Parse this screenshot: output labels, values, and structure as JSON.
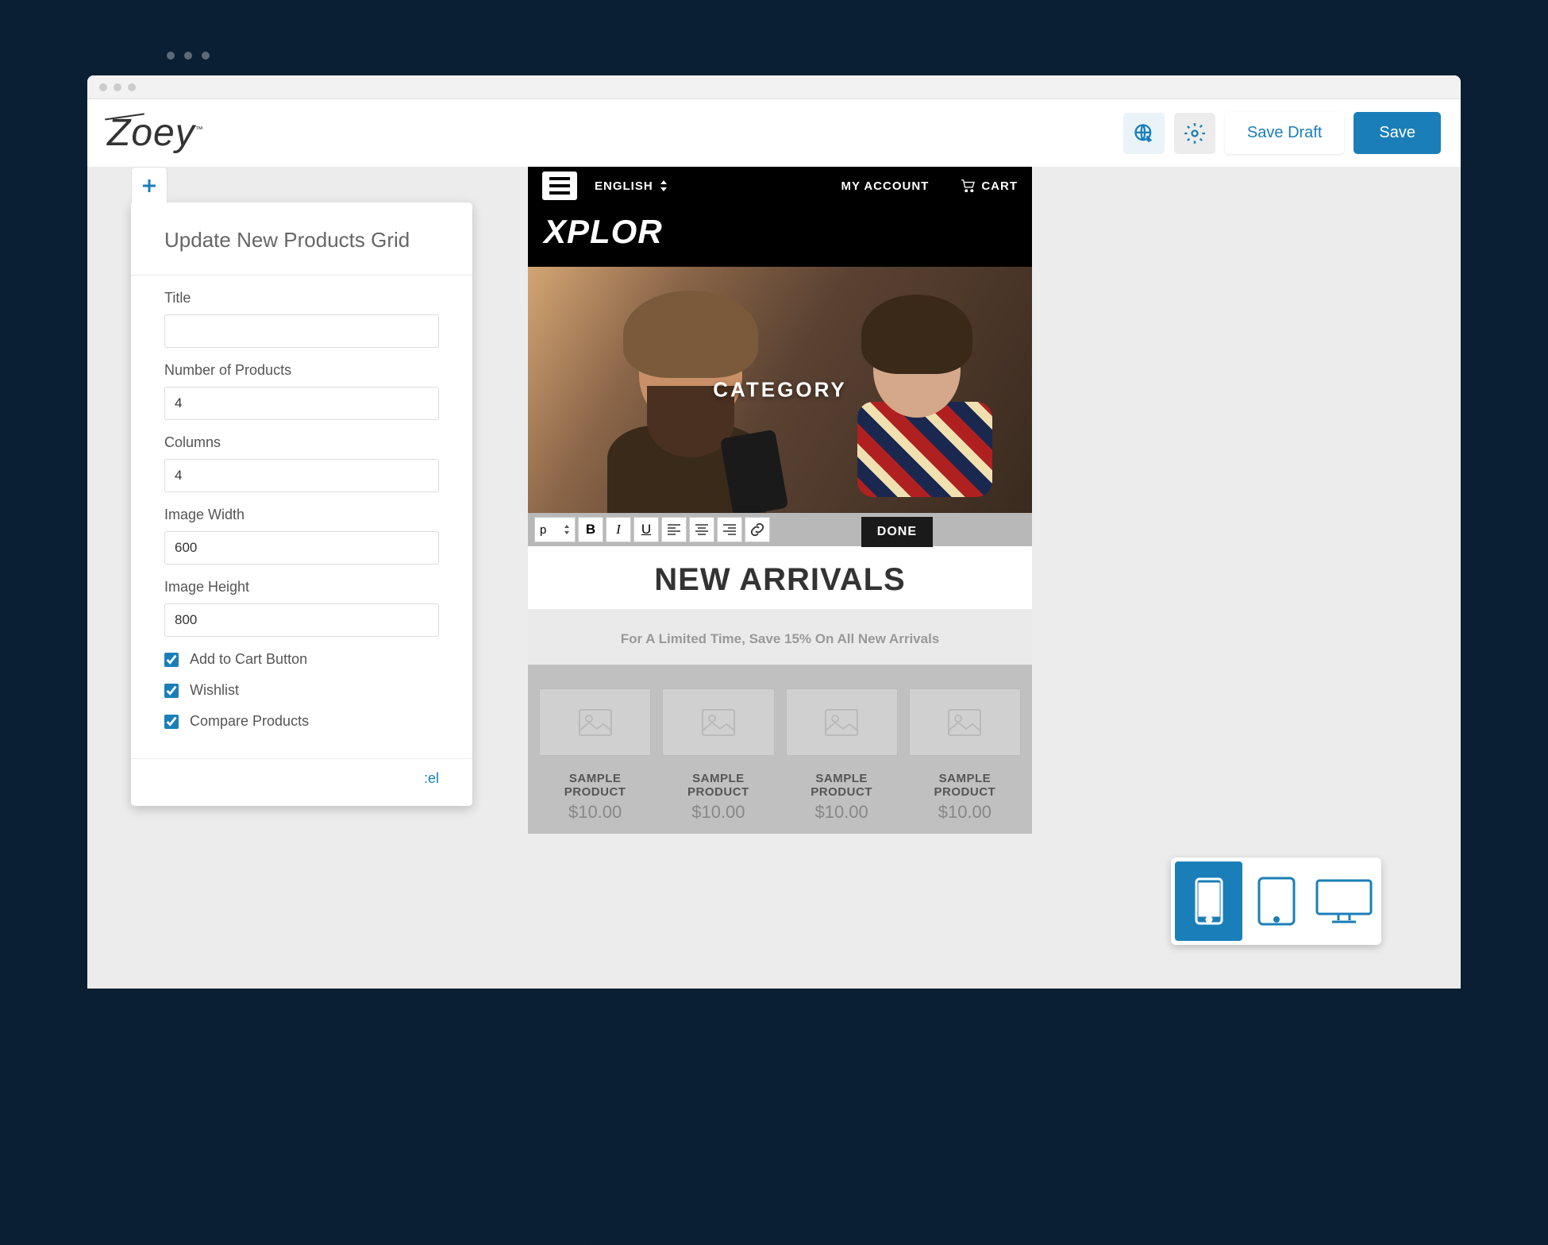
{
  "logo": "Zoey",
  "header": {
    "save_draft_label": "Save Draft",
    "save_label": "Save"
  },
  "panel": {
    "title": "Update New Products Grid",
    "fields": {
      "title_label": "Title",
      "title_value": "",
      "num_products_label": "Number of Products",
      "num_products_value": "4",
      "columns_label": "Columns",
      "columns_value": "4",
      "image_width_label": "Image Width",
      "image_width_value": "600",
      "image_height_label": "Image Height",
      "image_height_value": "800"
    },
    "checkboxes": {
      "add_to_cart_label": "Add to Cart Button",
      "wishlist_label": "Wishlist",
      "compare_label": "Compare Products"
    },
    "footer_link": ":el"
  },
  "preview": {
    "topbar": {
      "language": "ENGLISH",
      "my_account": "MY ACCOUNT",
      "cart": "CART"
    },
    "brand": "XPLOR",
    "hero_text": "CATEGORY",
    "format_bar": {
      "paragraph": "p",
      "done": "DONE"
    },
    "section": {
      "title": "NEW ARRIVALS",
      "subtitle": "For A Limited Time, Save 15% On All New Arrivals"
    },
    "products": [
      {
        "name": "SAMPLE PRODUCT",
        "price": "$10.00"
      },
      {
        "name": "SAMPLE PRODUCT",
        "price": "$10.00"
      },
      {
        "name": "SAMPLE PRODUCT",
        "price": "$10.00"
      },
      {
        "name": "SAMPLE PRODUCT",
        "price": "$10.00"
      }
    ]
  }
}
